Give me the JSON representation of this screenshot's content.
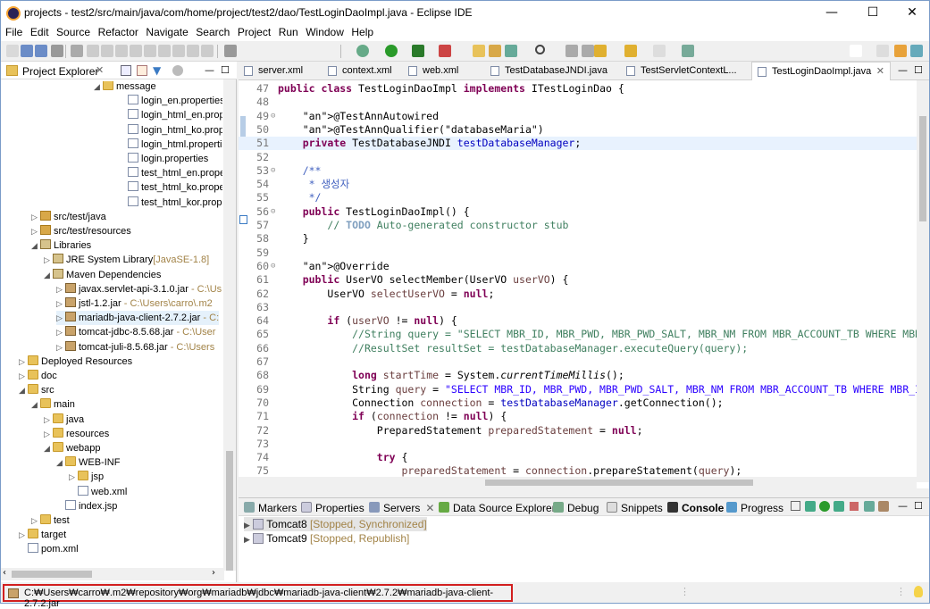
{
  "window": {
    "title": "projects - test2/src/main/java/com/home/project/test2/dao/TestLoginDaoImpl.java - Eclipse IDE"
  },
  "menu": [
    "File",
    "Edit",
    "Source",
    "Refactor",
    "Navigate",
    "Search",
    "Project",
    "Run",
    "Window",
    "Help"
  ],
  "left_panel": {
    "tab": "Project Explorer"
  },
  "tree": [
    {
      "label": "message",
      "indent": 7,
      "kind": "fold",
      "open": true
    },
    {
      "label": "login_en.properties",
      "indent": 9,
      "kind": "file"
    },
    {
      "label": "login_html_en.prope",
      "indent": 9,
      "kind": "file"
    },
    {
      "label": "login_html_ko.proper",
      "indent": 9,
      "kind": "file"
    },
    {
      "label": "login_html.propertie",
      "indent": 9,
      "kind": "file"
    },
    {
      "label": "login.properties",
      "indent": 9,
      "kind": "file"
    },
    {
      "label": "test_html_en.propert",
      "indent": 9,
      "kind": "file"
    },
    {
      "label": "test_html_ko.propert",
      "indent": 9,
      "kind": "file"
    },
    {
      "label": "test_html_kor.proper",
      "indent": 9,
      "kind": "file"
    },
    {
      "label": "src/test/java",
      "indent": 2,
      "kind": "pkg",
      "closed": true
    },
    {
      "label": "src/test/resources",
      "indent": 2,
      "kind": "pkg",
      "closed": true
    },
    {
      "label": "Libraries",
      "indent": 2,
      "kind": "lib",
      "open": true
    },
    {
      "label": "JRE System Library",
      "dec": "[JavaSE-1.8]",
      "indent": 3,
      "kind": "lib",
      "closed": true
    },
    {
      "label": "Maven Dependencies",
      "indent": 3,
      "kind": "lib",
      "open": true
    },
    {
      "label": "javax.servlet-api-3.1.0.jar",
      "dec": " - C:\\Us",
      "indent": 4,
      "kind": "jar",
      "closed": true
    },
    {
      "label": "jstl-1.2.jar",
      "dec": " - C:\\Users\\carro\\.m2",
      "indent": 4,
      "kind": "jar",
      "closed": true
    },
    {
      "label": "mariadb-java-client-2.7.2.jar",
      "dec": " - C:",
      "indent": 4,
      "kind": "jar",
      "closed": true,
      "selected": true
    },
    {
      "label": "tomcat-jdbc-8.5.68.jar",
      "dec": " - C:\\User",
      "indent": 4,
      "kind": "jar",
      "closed": true
    },
    {
      "label": "tomcat-juli-8.5.68.jar",
      "dec": " - C:\\Users",
      "indent": 4,
      "kind": "jar",
      "closed": true
    },
    {
      "label": "Deployed Resources",
      "indent": 1,
      "kind": "fold",
      "closed": true
    },
    {
      "label": "doc",
      "indent": 1,
      "kind": "fold",
      "closed": true
    },
    {
      "label": "src",
      "indent": 1,
      "kind": "fold",
      "open": true
    },
    {
      "label": "main",
      "indent": 2,
      "kind": "fold",
      "open": true
    },
    {
      "label": "java",
      "indent": 3,
      "kind": "fold",
      "closed": true
    },
    {
      "label": "resources",
      "indent": 3,
      "kind": "fold",
      "closed": true
    },
    {
      "label": "webapp",
      "indent": 3,
      "kind": "fold",
      "open": true
    },
    {
      "label": "WEB-INF",
      "indent": 4,
      "kind": "fold",
      "open": true
    },
    {
      "label": "jsp",
      "indent": 5,
      "kind": "fold",
      "closed": true
    },
    {
      "label": "web.xml",
      "indent": 5,
      "kind": "file"
    },
    {
      "label": "index.jsp",
      "indent": 4,
      "kind": "file"
    },
    {
      "label": "test",
      "indent": 2,
      "kind": "fold",
      "closed": true
    },
    {
      "label": "target",
      "indent": 1,
      "kind": "fold",
      "closed": true
    },
    {
      "label": "pom.xml",
      "indent": 1,
      "kind": "file"
    }
  ],
  "editor": {
    "tabs": [
      "server.xml",
      "context.xml",
      "web.xml",
      "TestDatabaseJNDI.java",
      "TestServletContextL...",
      "TestLoginDaoImpl.java"
    ],
    "active_tab": "TestLoginDaoImpl.java",
    "current_line": 51
  },
  "code": [
    {
      "n": "47",
      "t": "public class TestLoginDaoImpl implements ITestLoginDao {"
    },
    {
      "n": "48",
      "t": ""
    },
    {
      "n": "49",
      "t": "    @TestAnnAutowired"
    },
    {
      "n": "50",
      "t": "    @TestAnnQualifier(\"databaseMaria\")"
    },
    {
      "n": "51",
      "t": "    private TestDatabaseJNDI testDatabaseManager;"
    },
    {
      "n": "52",
      "t": ""
    },
    {
      "n": "53",
      "t": "    /**"
    },
    {
      "n": "54",
      "t": "     * 생성자"
    },
    {
      "n": "55",
      "t": "     */"
    },
    {
      "n": "56",
      "t": "    public TestLoginDaoImpl() {"
    },
    {
      "n": "57",
      "t": "        // TODO Auto-generated constructor stub"
    },
    {
      "n": "58",
      "t": "    }"
    },
    {
      "n": "59",
      "t": ""
    },
    {
      "n": "60",
      "t": "    @Override"
    },
    {
      "n": "61",
      "t": "    public UserVO selectMember(UserVO userVO) {"
    },
    {
      "n": "62",
      "t": "        UserVO selectUserVO = null;"
    },
    {
      "n": "63",
      "t": ""
    },
    {
      "n": "64",
      "t": "        if (userVO != null) {"
    },
    {
      "n": "65",
      "t": "            //String query = \"SELECT MBR_ID, MBR_PWD, MBR_PWD_SALT, MBR_NM FROM MBR_ACCOUNT_TB WHERE MBR_"
    },
    {
      "n": "66",
      "t": "            //ResultSet resultSet = testDatabaseManager.executeQuery(query);"
    },
    {
      "n": "67",
      "t": ""
    },
    {
      "n": "68",
      "t": "            long startTime = System.currentTimeMillis();"
    },
    {
      "n": "69",
      "t": "            String query = \"SELECT MBR_ID, MBR_PWD, MBR_PWD_SALT, MBR_NM FROM MBR_ACCOUNT_TB WHERE MBR_ID"
    },
    {
      "n": "70",
      "t": "            Connection connection = testDatabaseManager.getConnection();"
    },
    {
      "n": "71",
      "t": "            if (connection != null) {"
    },
    {
      "n": "72",
      "t": "                PreparedStatement preparedStatement = null;"
    },
    {
      "n": "73",
      "t": ""
    },
    {
      "n": "74",
      "t": "                try {"
    },
    {
      "n": "75",
      "t": "                    preparedStatement = connection.prepareStatement(query);"
    }
  ],
  "bottom_panel": {
    "tabs": [
      "Markers",
      "Properties",
      "Servers",
      "Data Source Explorer",
      "Debug",
      "Snippets",
      "Console",
      "Progress"
    ],
    "active_tab": "Console",
    "servers": [
      {
        "name": "Tomcat8",
        "state": "[Stopped, Synchronized]"
      },
      {
        "name": "Tomcat9",
        "state": "[Stopped, Republish]"
      }
    ]
  },
  "status": {
    "path": "C:₩Users₩carro₩.m2₩repository₩org₩mariadb₩jdbc₩mariadb-java-client₩2.7.2₩mariadb-java-client-2.7.2.jar"
  },
  "colors": {
    "keyword": "#7f0055",
    "string": "#2a00ff",
    "comment": "#3f7f5f",
    "highlight_border": "#d21f1f"
  }
}
